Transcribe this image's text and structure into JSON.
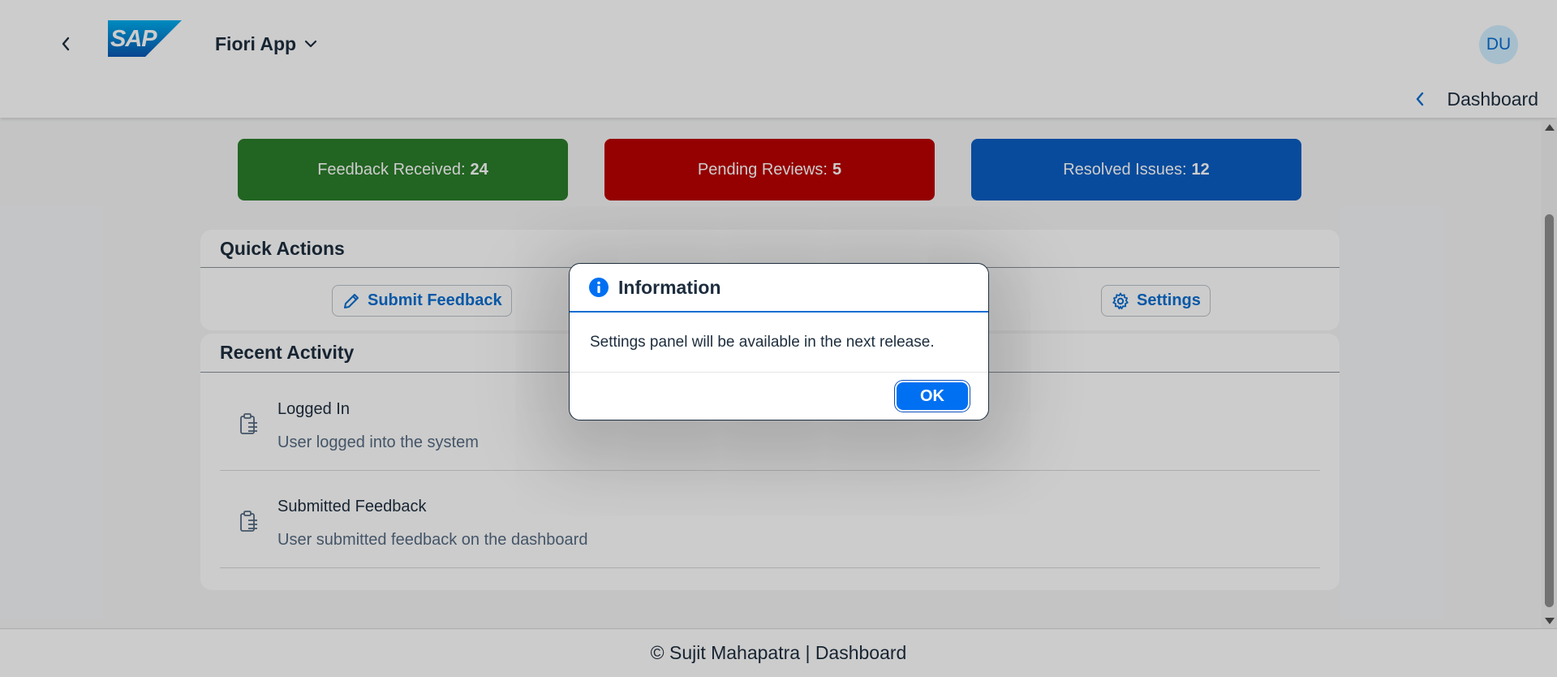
{
  "shell": {
    "logo_text": "SAP",
    "app_title": "Fiori App",
    "avatar_initials": "DU",
    "breadcrumb": "Dashboard"
  },
  "stats": [
    {
      "label": "Feedback Received:",
      "value": "24",
      "color": "#2b7d2b"
    },
    {
      "label": "Pending Reviews:",
      "value": "5",
      "color": "#bb0000"
    },
    {
      "label": "Resolved Issues:",
      "value": "12",
      "color": "#0a5ec4"
    }
  ],
  "quick_actions": {
    "title": "Quick Actions",
    "submit_label": "Submit Feedback",
    "settings_label": "Settings"
  },
  "recent_activity": {
    "title": "Recent Activity",
    "items": [
      {
        "title": "Logged In",
        "description": "User logged into the system",
        "icon": "clipboard-list-icon"
      },
      {
        "title": "Submitted Feedback",
        "description": "User submitted feedback on the dashboard",
        "icon": "clipboard-list-icon"
      }
    ]
  },
  "footer": {
    "text": "© Sujit Mahapatra | Dashboard"
  },
  "dialog": {
    "title": "Information",
    "message": "Settings panel will be available in the next release.",
    "ok_label": "OK",
    "icon": "information-icon"
  },
  "colors": {
    "accent": "#0a6ed1",
    "button_emphasized": "#0070f2",
    "text": "#1d2d3e"
  }
}
